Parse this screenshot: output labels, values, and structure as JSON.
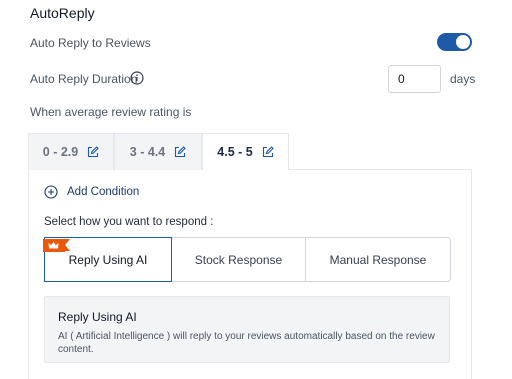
{
  "section": {
    "title": "AutoReply"
  },
  "auto_reply": {
    "label": "Auto Reply to Reviews",
    "enabled": true,
    "accent": "#1e5aa8"
  },
  "duration": {
    "label": "Auto Reply Duration",
    "value": "0",
    "unit": "days",
    "icon": "info-icon"
  },
  "rating": {
    "label": "When average review rating is"
  },
  "tabs": [
    {
      "label": "0 - 2.9",
      "icon": "edit-icon"
    },
    {
      "label": "3 - 4.4",
      "icon": "edit-icon"
    },
    {
      "label": "4.5 - 5",
      "icon": "edit-icon",
      "active": true
    }
  ],
  "add_condition": {
    "label": "Add Condition",
    "icon": "plus-circle-icon"
  },
  "response": {
    "prompt": "Select how you want to respond :",
    "options": [
      {
        "label": "Reply Using AI",
        "selected": true,
        "badge_icon": "crown-icon"
      },
      {
        "label": "Stock Response"
      },
      {
        "label": "Manual Response"
      }
    ]
  },
  "description": {
    "title": "Reply Using AI",
    "text": "AI ( Artificial Intelligence ) will reply to your reviews automatically based on the review content."
  },
  "colors": {
    "accent": "#1e5aa8",
    "badge": "#ea580c"
  }
}
